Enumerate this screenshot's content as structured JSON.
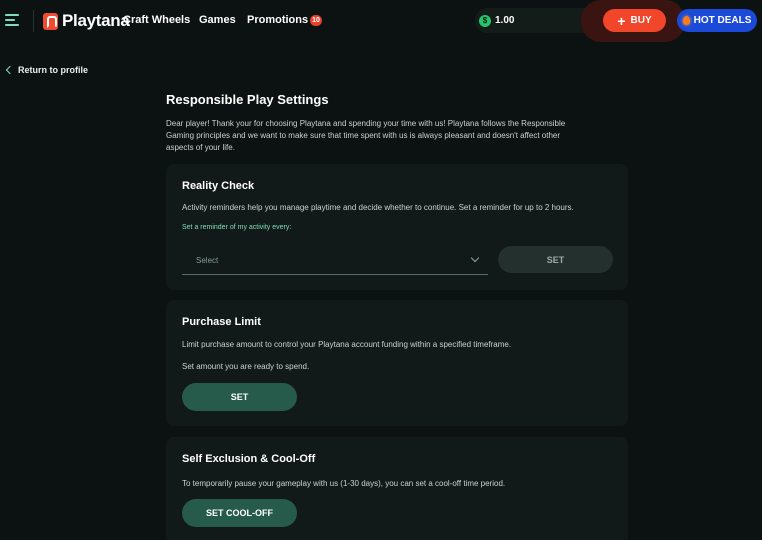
{
  "header": {
    "brand": "Playtana",
    "nav": [
      {
        "label": "Craft Wheels"
      },
      {
        "label": "Games"
      },
      {
        "label": "Promotions",
        "badge": "10"
      }
    ],
    "balance": {
      "amount": "1.00",
      "coin_icon": "coin-icon"
    },
    "buy_label": "BUY",
    "hot_deals_label": "HOT DEALS",
    "colors": {
      "buy": "#f2462b",
      "hot_deals": "#1b49d8",
      "accent": "#7fdcb8"
    }
  },
  "back_link": {
    "label": "Return to profile"
  },
  "page": {
    "title": "Responsible Play Settings",
    "intro_lines": [
      "Dear player! Thank your for choosing Playtana and spending your time with us! Playtana follows the Responsible",
      "Gaming principles and we want to make sure that time spent with us is always pleasant and doesn't affect other",
      "aspects of your life."
    ]
  },
  "reality_check": {
    "title": "Reality Check",
    "description": "Activity reminders help you manage playtime and decide whether to continue. Set a reminder for up to 2 hours.",
    "hint": "Set a reminder of my activity every:",
    "select_placeholder": "Select",
    "button": "SET"
  },
  "purchase_limit": {
    "title": "Purchase Limit",
    "description": "Limit purchase amount to control your Playtana account funding within a specified timeframe.",
    "sub": "Set amount you are ready to spend.",
    "button": "SET"
  },
  "self_exclusion": {
    "title": "Self Exclusion & Cool-Off",
    "description": "To temporarily pause your gameplay with us (1-30 days), you can set a cool-off time period.",
    "button": "SET COOL-OFF"
  }
}
